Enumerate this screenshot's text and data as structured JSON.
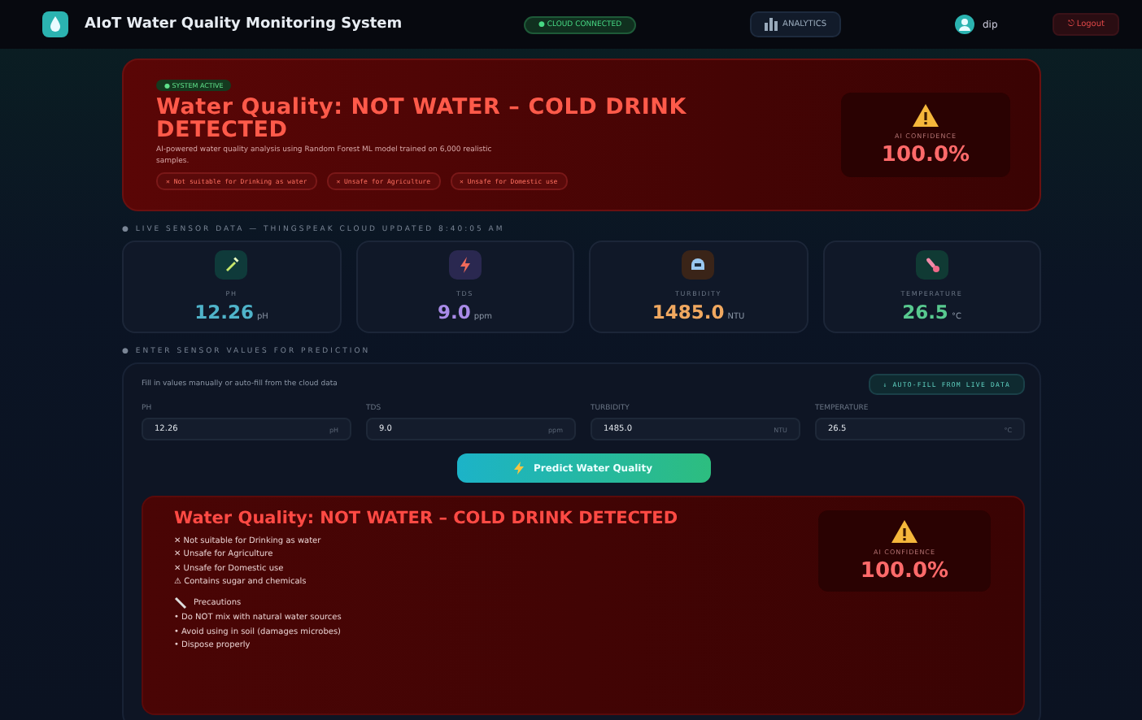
{
  "header": {
    "title": "AIoT Water Quality Monitoring System",
    "cloud_status": "● CLOUD CONNECTED",
    "analytics": "ANALYTICS",
    "user": "dip",
    "logout": "⎋ Logout"
  },
  "hero": {
    "badge": "● SYSTEM ACTIVE",
    "title": "Water Quality: NOT WATER – COLD DRINK DETECTED",
    "description": "AI-powered water quality analysis using Random Forest ML model trained on 6,000 realistic samples.",
    "tags": [
      "✕ Not suitable for Drinking as water",
      "✕ Unsafe for Agriculture",
      "✕ Unsafe for Domestic use"
    ],
    "confidence_label": "AI CONFIDENCE",
    "confidence": "100.0%"
  },
  "live_section": {
    "label": "● LIVE SENSOR DATA — THINGSPEAK CLOUD UPDATED 8:40:05 AM"
  },
  "sensors": [
    {
      "kind": "ph",
      "label": "PH",
      "value": "12.26",
      "unit": "pH",
      "color": "#4fb3c9"
    },
    {
      "kind": "tds",
      "label": "TDS",
      "value": "9.0",
      "unit": "ppm",
      "color": "#a98be8"
    },
    {
      "kind": "turbidity",
      "label": "TURBIDITY",
      "value": "1485.0",
      "unit": "NTU",
      "color": "#f0a860"
    },
    {
      "kind": "temperature",
      "label": "TEMPERATURE",
      "value": "26.5",
      "unit": "°C",
      "color": "#58c98f"
    }
  ],
  "input_section": {
    "label": "● ENTER SENSOR VALUES FOR PREDICTION",
    "hint": "Fill in values manually or auto-fill from the cloud data",
    "autofill": "↓ AUTO-FILL FROM LIVE DATA",
    "fields": [
      {
        "label": "PH",
        "value": "12.26",
        "unit": "pH"
      },
      {
        "label": "TDS",
        "value": "9.0",
        "unit": "ppm"
      },
      {
        "label": "TURBIDITY",
        "value": "1485.0",
        "unit": "NTU"
      },
      {
        "label": "TEMPERATURE",
        "value": "26.5",
        "unit": "°C"
      }
    ],
    "predict": "Predict Water Quality"
  },
  "result": {
    "title": "Water Quality: NOT WATER – COLD DRINK DETECTED",
    "items": [
      "✕ Not suitable for Drinking as water",
      "✕ Unsafe for Agriculture",
      "✕ Unsafe for Domestic use",
      "⚠ Contains sugar and chemicals"
    ],
    "precautions_heading": "Precautions",
    "precautions": [
      "• Do NOT mix with natural water sources",
      "• Avoid using in soil (damages microbes)",
      "• Dispose properly"
    ],
    "confidence_label": "AI CONFIDENCE",
    "confidence": "100.0%"
  }
}
